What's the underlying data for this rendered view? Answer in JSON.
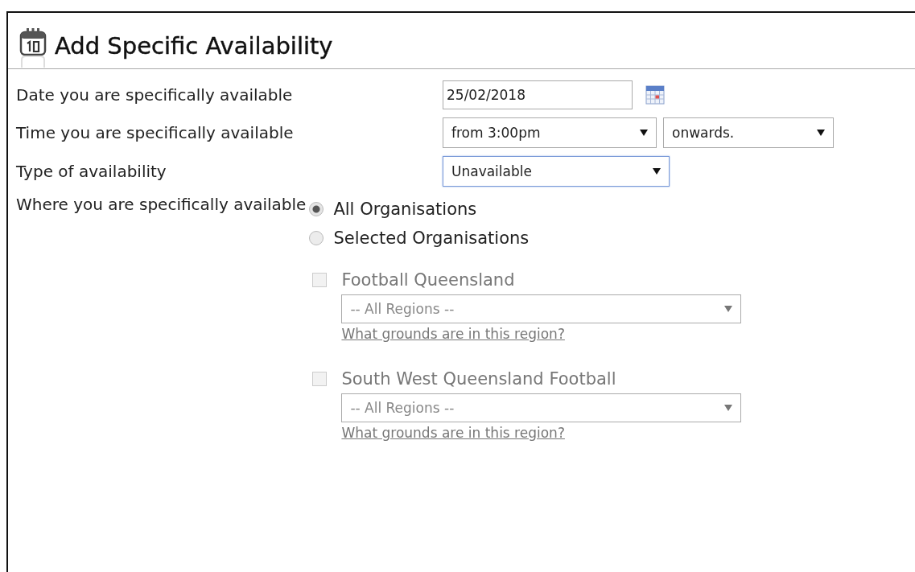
{
  "title": "Add Specific Availability",
  "date": {
    "label": "Date you are specifically available",
    "value": "25/02/2018"
  },
  "time": {
    "label": "Time you are specifically available",
    "from": "from 3:00pm",
    "to": "onwards."
  },
  "type": {
    "label": "Type of availability",
    "value": "Unavailable",
    "focused": true
  },
  "where": {
    "label": "Where you are specifically available",
    "options": [
      {
        "label": "All Organisations",
        "selected": true
      },
      {
        "label": "Selected Organisations",
        "selected": false
      }
    ]
  },
  "organisations": [
    {
      "name": "Football Queensland",
      "checked": false,
      "disabled": true,
      "region": "-- All Regions --",
      "link": "What grounds are in this region?"
    },
    {
      "name": "South West Queensland Football",
      "checked": false,
      "disabled": true,
      "region": "-- All Regions --",
      "link": "What grounds are in this region?"
    }
  ]
}
